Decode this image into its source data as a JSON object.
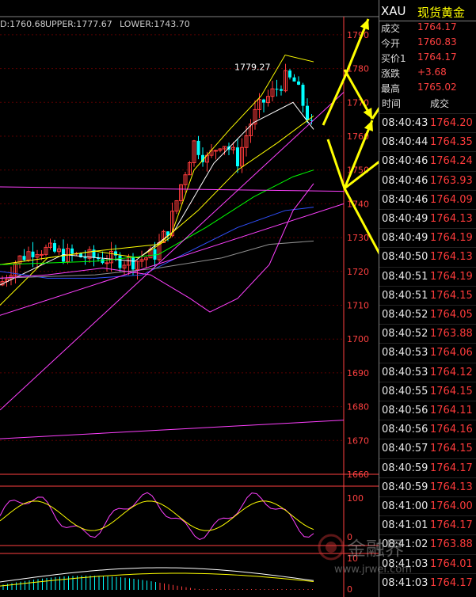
{
  "header": {
    "symbol": "XAU",
    "name": "现货黄金",
    "boll": {
      "mid": "D:1760.68",
      "upper": "UPPER:1777.67",
      "lower": "LOWER:1743.70"
    },
    "colors": {
      "mid": "#ffffff",
      "upper": "#ffff00",
      "lower": "#ff40ff"
    }
  },
  "quote": [
    {
      "label": "成交",
      "value": "1764.17"
    },
    {
      "label": "今开",
      "value": "1760.83"
    },
    {
      "label": "买价1",
      "value": "1764.17"
    },
    {
      "label": "涨跌",
      "value": "+3.68"
    },
    {
      "label": "最高",
      "value": "1765.02"
    }
  ],
  "ticks_header": {
    "time": "时间",
    "price": "成交"
  },
  "ticks": [
    {
      "time": "08:40:43",
      "price": "1764.20"
    },
    {
      "time": "08:40:44",
      "price": "1764.35"
    },
    {
      "time": "08:40:46",
      "price": "1764.24"
    },
    {
      "time": "08:40:46",
      "price": "1763.93"
    },
    {
      "time": "08:40:46",
      "price": "1764.09"
    },
    {
      "time": "08:40:49",
      "price": "1764.13"
    },
    {
      "time": "08:40:49",
      "price": "1764.19"
    },
    {
      "time": "08:40:50",
      "price": "1764.13"
    },
    {
      "time": "08:40:51",
      "price": "1764.19"
    },
    {
      "time": "08:40:51",
      "price": "1764.15"
    },
    {
      "time": "08:40:52",
      "price": "1764.05"
    },
    {
      "time": "08:40:52",
      "price": "1763.88"
    },
    {
      "time": "08:40:53",
      "price": "1764.06"
    },
    {
      "time": "08:40:53",
      "price": "1764.12"
    },
    {
      "time": "08:40:55",
      "price": "1764.15"
    },
    {
      "time": "08:40:56",
      "price": "1764.11"
    },
    {
      "time": "08:40:56",
      "price": "1764.16"
    },
    {
      "time": "08:40:57",
      "price": "1764.15"
    },
    {
      "time": "08:40:59",
      "price": "1764.17"
    },
    {
      "time": "08:40:59",
      "price": "1764.13"
    },
    {
      "time": "08:41:00",
      "price": "1764.00"
    },
    {
      "time": "08:41:01",
      "price": "1764.17"
    },
    {
      "time": "08:41:02",
      "price": "1763.88"
    },
    {
      "time": "08:41:03",
      "price": "1764.01"
    },
    {
      "time": "08:41:03",
      "price": "1764.17"
    }
  ],
  "chart_data": {
    "type": "candlestick",
    "price_axis": {
      "ticks": [
        1660,
        1670,
        1680,
        1690,
        1700,
        1710,
        1720,
        1730,
        1740,
        1750,
        1760,
        1770,
        1780,
        1790
      ],
      "range": [
        1660,
        1794
      ]
    },
    "peak_annotation": "1779.27",
    "osc_axis_ticks": [
      "100",
      "0"
    ],
    "macd_axis_ticks": [
      "10",
      "0"
    ],
    "colors": {
      "up": "#ff3b3b",
      "down": "#00ffff",
      "axis": "#ff4040",
      "ma_white": "#ffffff",
      "ma_yellow": "#ffff00",
      "ma_green": "#00ff00",
      "ma_blue": "#3050ff",
      "ma_gray": "#909090",
      "boll_mag": "#ff40ff",
      "arrow": "#ffff00"
    }
  },
  "watermark": {
    "brand": "金融界",
    "url": "www.jrwel.com"
  }
}
